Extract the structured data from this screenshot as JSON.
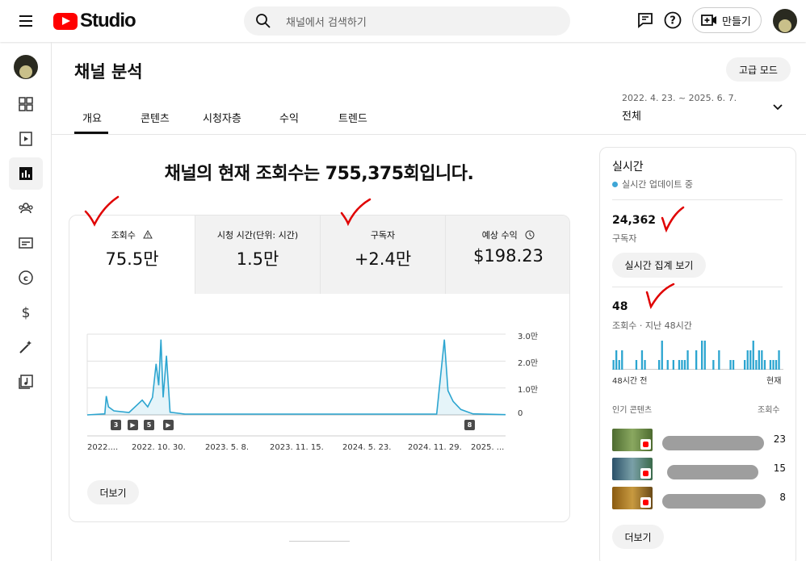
{
  "app": {
    "logo_text": "Studio"
  },
  "header": {
    "search_placeholder": "채널에서 검색하기",
    "create_label": "만들기"
  },
  "page": {
    "title": "채널 분석",
    "advanced_mode_label": "고급 모드",
    "tabs": [
      {
        "label": "개요",
        "active": true
      },
      {
        "label": "콘텐츠",
        "active": false
      },
      {
        "label": "시청자층",
        "active": false
      },
      {
        "label": "수익",
        "active": false
      },
      {
        "label": "트렌드",
        "active": false
      }
    ],
    "date_range": "2022. 4. 23. ~ 2025. 6. 7.",
    "date_period": "전체",
    "headline": "채널의 현재 조회수는 755,375회입니다."
  },
  "metrics": [
    {
      "label": "조회수",
      "value": "75.5만",
      "icon": "warning-icon"
    },
    {
      "label": "시청 시간(단위: 시간)",
      "value": "1.5만"
    },
    {
      "label": "구독자",
      "value": "+2.4만"
    },
    {
      "label": "예상 수익",
      "value": "$198.23",
      "icon": "clock-icon"
    }
  ],
  "chart_data": {
    "type": "area",
    "color": "#2ca5d0",
    "x_tick_labels": [
      "2022....",
      "2022. 10. 30.",
      "2023. 5. 8.",
      "2023. 11. 15.",
      "2024. 5. 23.",
      "2024. 11. 29.",
      "2025. ..."
    ],
    "y_tick_labels": [
      "3.0만",
      "2.0만",
      "1.0만",
      "0"
    ],
    "ylim": [
      0,
      30000
    ],
    "markers": [
      "3",
      "▶",
      "5",
      "▶",
      "8"
    ],
    "series_points": [
      {
        "x": "2022-04-23",
        "y": 0
      },
      {
        "x": "2022-06-10",
        "y": 400
      },
      {
        "x": "2022-06-14",
        "y": 7000
      },
      {
        "x": "2022-06-20",
        "y": 3000
      },
      {
        "x": "2022-07-05",
        "y": 1500
      },
      {
        "x": "2022-08-15",
        "y": 900
      },
      {
        "x": "2022-09-20",
        "y": 5500
      },
      {
        "x": "2022-10-05",
        "y": 3000
      },
      {
        "x": "2022-10-18",
        "y": 6500
      },
      {
        "x": "2022-10-28",
        "y": 19000
      },
      {
        "x": "2022-11-04",
        "y": 11000
      },
      {
        "x": "2022-11-10",
        "y": 28000
      },
      {
        "x": "2022-11-16",
        "y": 6500
      },
      {
        "x": "2022-11-25",
        "y": 22000
      },
      {
        "x": "2022-12-05",
        "y": 1000
      },
      {
        "x": "2023-01-15",
        "y": 300
      },
      {
        "x": "2024-12-01",
        "y": 300
      },
      {
        "x": "2024-12-22",
        "y": 28000
      },
      {
        "x": "2025-01-01",
        "y": 9000
      },
      {
        "x": "2025-01-15",
        "y": 5000
      },
      {
        "x": "2025-02-05",
        "y": 2000
      },
      {
        "x": "2025-03-10",
        "y": 400
      },
      {
        "x": "2025-06-07",
        "y": 100
      }
    ]
  },
  "card": {
    "more_label": "더보기"
  },
  "realtime": {
    "title": "실시간",
    "live_label": "실시간 업데이트 중",
    "subscribers": "24,362",
    "subscribers_label": "구독자",
    "realtime_btn": "실시간 집계 보기",
    "views": "48",
    "views_label": "조회수 · 지난 48시간",
    "bars_left_label": "48시간 전",
    "bars_right_label": "현재",
    "bars": [
      1,
      2,
      1,
      2,
      0,
      0,
      0,
      0,
      1,
      0,
      2,
      1,
      0,
      0,
      0,
      0,
      1,
      3,
      0,
      1,
      0,
      1,
      0,
      1,
      1,
      1,
      2,
      0,
      0,
      2,
      0,
      3,
      3,
      0,
      0,
      1,
      0,
      2,
      0,
      0,
      0,
      1,
      1,
      0,
      0,
      0,
      1,
      2,
      2,
      3,
      1,
      2,
      2,
      1,
      0,
      1,
      1,
      1,
      2,
      0
    ],
    "top_content_label": "인기 콘텐츠",
    "views_col_label": "조회수",
    "top_content": [
      {
        "views": "23",
        "color": "#5a7a3a"
      },
      {
        "views": "15",
        "color": "#3a6a8a"
      },
      {
        "views": "8",
        "color": "#b07a20"
      }
    ],
    "more_label": "더보기"
  }
}
